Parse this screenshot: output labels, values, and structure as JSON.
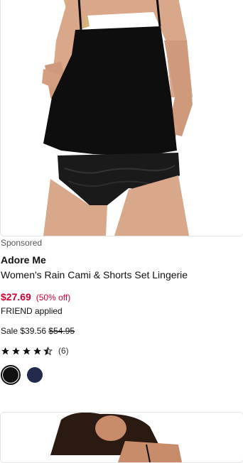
{
  "product": {
    "sponsored_label": "Sponsored",
    "brand": "Adore Me",
    "title": "Women's Rain Cami & Shorts Set Lingerie",
    "price": "$27.69",
    "discount": "(50% off)",
    "promo": "FRIEND applied",
    "sale_prefix": "Sale $39.56",
    "original_price": "$54.95",
    "rating": 4.5,
    "review_count": "(6)",
    "swatches": [
      {
        "color": "#111111",
        "selected": true
      },
      {
        "color": "#222a4e",
        "selected": false
      }
    ]
  },
  "colors": {
    "price": "#cc0033",
    "border": "#e3e3e3"
  }
}
